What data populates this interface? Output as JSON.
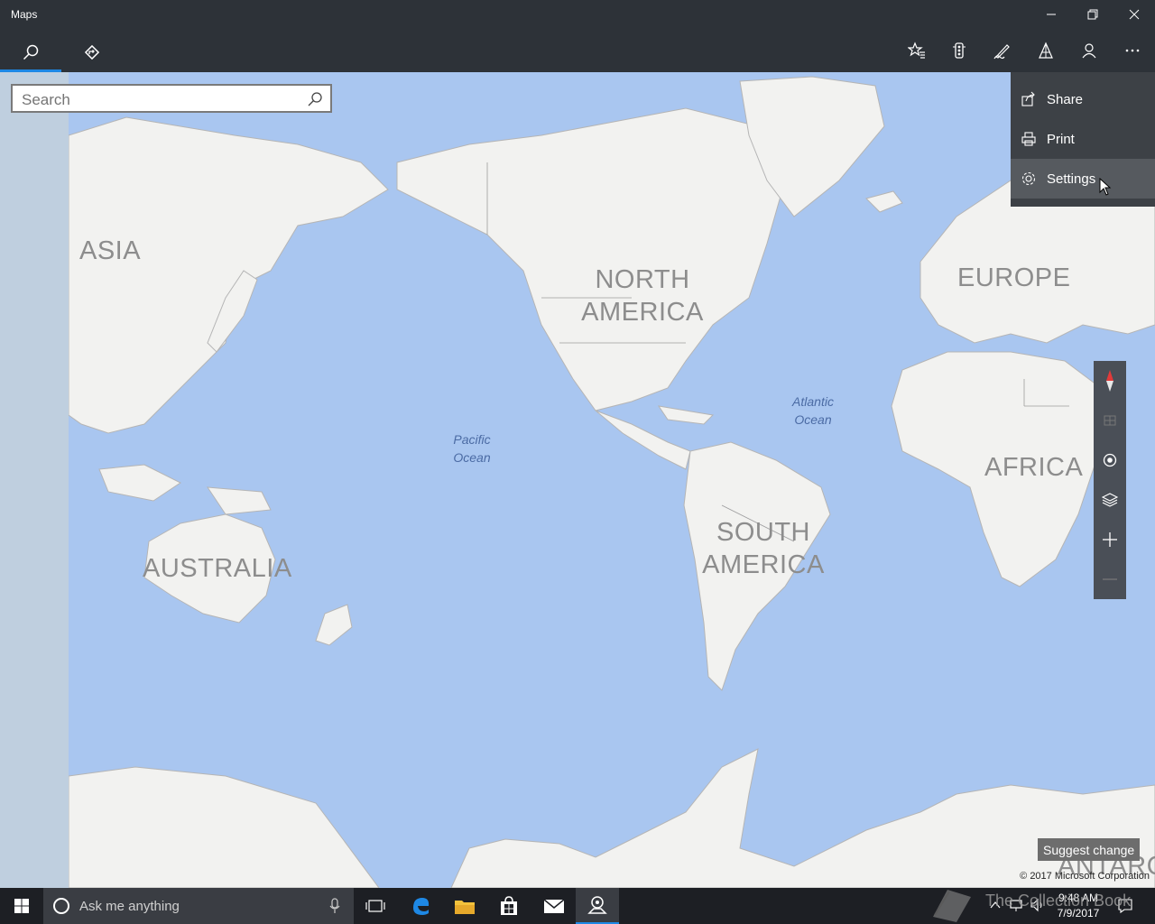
{
  "window": {
    "title": "Maps"
  },
  "search": {
    "placeholder": "Search"
  },
  "menu": {
    "items": [
      "Share",
      "Print",
      "Settings"
    ]
  },
  "map": {
    "continents": [
      "ASIA",
      "NORTH AMERICA",
      "EUROPE",
      "AFRICA",
      "SOUTH AMERICA",
      "AUSTRALIA",
      "ANTARC"
    ],
    "oceans": {
      "pacific": "Pacific Ocean",
      "atlantic": "Atlantic Ocean"
    },
    "suggest_label": "Suggest change",
    "copyright": "© 2017 Microsoft Corporation"
  },
  "taskbar": {
    "cortana_placeholder": "Ask me anything",
    "time": "9:48 AM",
    "date": "7/9/2017"
  },
  "watermark": "The Collection Book",
  "icons": {
    "tabs": [
      "search-icon",
      "directions-icon"
    ],
    "toolbar": [
      "favorites-icon",
      "traffic-icon",
      "ink-icon",
      "3d-cities-icon",
      "account-icon",
      "more-icon"
    ],
    "map_controls": [
      "compass-icon",
      "tilt-icon",
      "locate-icon",
      "layers-icon",
      "zoom-in-icon",
      "zoom-out-icon"
    ]
  },
  "colors": {
    "accent": "#1e88e5",
    "water": "#a9c6f0",
    "land": "#f2f2f0",
    "chrome": "#2d3238"
  }
}
